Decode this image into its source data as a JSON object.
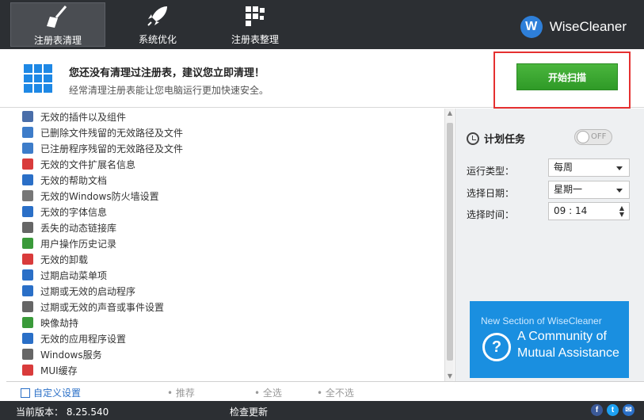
{
  "toolbar": {
    "tabs": [
      {
        "label": "注册表清理",
        "icon": "broom-icon",
        "active": true
      },
      {
        "label": "系统优化",
        "icon": "rocket-icon",
        "active": false
      },
      {
        "label": "注册表整理",
        "icon": "blocks-icon",
        "active": false
      }
    ],
    "brand": {
      "logo": "W",
      "name": "WiseCleaner"
    }
  },
  "banner": {
    "title": "您还没有清理过注册表，建议您立即清理！",
    "subtitle": "经常清理注册表能让您电脑运行更加快速安全。",
    "scan_button": "开始扫描"
  },
  "list": {
    "items": [
      {
        "label": "无效的插件以及组件",
        "icon": "plugin-icon",
        "color": "#4a6ea9"
      },
      {
        "label": "已删除文件残留的无效路径及文件",
        "icon": "window-icon",
        "color": "#3d7cc9"
      },
      {
        "label": "已注册程序残留的无效路径及文件",
        "icon": "list-icon",
        "color": "#3d7cc9"
      },
      {
        "label": "无效的文件扩展名信息",
        "icon": "file-error-icon",
        "color": "#d93b3b"
      },
      {
        "label": "无效的帮助文档",
        "icon": "help-doc-icon",
        "color": "#2a6fc7"
      },
      {
        "label": "无效的Windows防火墙设置",
        "icon": "firewall-icon",
        "color": "#777777"
      },
      {
        "label": "无效的字体信息",
        "icon": "font-icon",
        "color": "#2a6fc7"
      },
      {
        "label": "丢失的动态链接库",
        "icon": "dll-icon",
        "color": "#666666"
      },
      {
        "label": "用户操作历史记录",
        "icon": "history-icon",
        "color": "#3a9a3a"
      },
      {
        "label": "无效的卸载",
        "icon": "uninstall-icon",
        "color": "#d93b3b"
      },
      {
        "label": "过期启动菜单项",
        "icon": "start-menu-icon",
        "color": "#2a6fc7"
      },
      {
        "label": "过期或无效的启动程序",
        "icon": "startup-icon",
        "color": "#2a6fc7"
      },
      {
        "label": "过期或无效的声音或事件设置",
        "icon": "sound-icon",
        "color": "#666666"
      },
      {
        "label": "映像劫持",
        "icon": "bug-icon",
        "color": "#3a9a3a"
      },
      {
        "label": "无效的应用程序设置",
        "icon": "app-settings-icon",
        "color": "#2a6fc7"
      },
      {
        "label": "Windows服务",
        "icon": "gear-icon",
        "color": "#666666"
      },
      {
        "label": "MUI缓存",
        "icon": "cache-icon",
        "color": "#d93b3b"
      }
    ]
  },
  "schedule": {
    "title": "计划任务",
    "toggle_state": "OFF",
    "run_type_label": "运行类型：",
    "run_type_value": "每周",
    "date_label": "选择日期：",
    "date_value": "星期一",
    "time_label": "选择时间：",
    "time_value": "09 : 14"
  },
  "ad": {
    "line_top": "New Section of WiseCleaner",
    "line1": "A Community of",
    "line2": "Mutual Assistance"
  },
  "actions": {
    "custom": "自定义设置",
    "recommend": "推荐",
    "select_all": "全选",
    "select_none": "全不选"
  },
  "status": {
    "version": "当前版本： 8.25.540",
    "update": "检查更新"
  },
  "social": [
    {
      "name": "facebook-icon",
      "glyph": "f",
      "color": "#3b5998"
    },
    {
      "name": "twitter-icon",
      "glyph": "t",
      "color": "#1da1f2"
    },
    {
      "name": "mail-icon",
      "glyph": "✉",
      "color": "#2a6fc7"
    }
  ]
}
